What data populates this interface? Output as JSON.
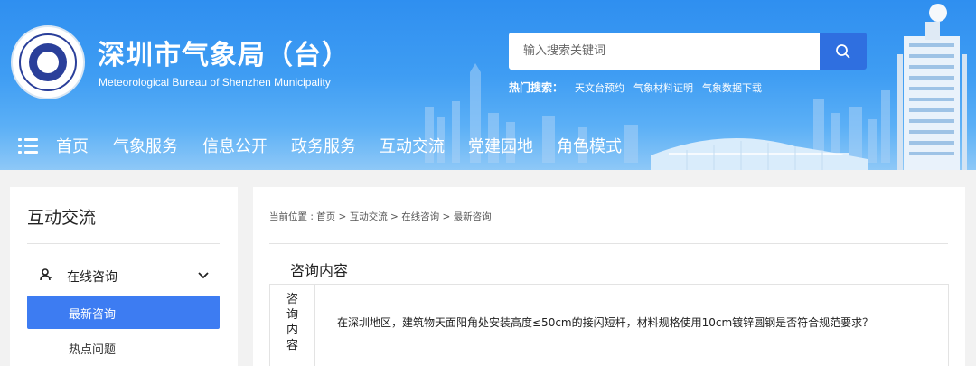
{
  "header": {
    "title": "深圳市气象局（台）",
    "subtitle": "Meteorological Bureau of Shenzhen Municipality",
    "search": {
      "placeholder": "输入搜索关键词"
    },
    "hot_search_label": "热门搜索：",
    "hot_links": [
      "天文台预约",
      "气象材料证明",
      "气象数据下载"
    ]
  },
  "nav": {
    "items": [
      "首页",
      "气象服务",
      "信息公开",
      "政务服务",
      "互动交流",
      "党建园地",
      "角色模式"
    ]
  },
  "sidebar": {
    "title": "互动交流",
    "group_label": "在线咨询",
    "items": [
      "最新咨询",
      "热点问题"
    ],
    "active_index": 0
  },
  "breadcrumb": {
    "prefix": "当前位置 : ",
    "crumbs": [
      "首页",
      "互动交流",
      "在线咨询",
      "最新咨询"
    ],
    "separator": " > "
  },
  "content": {
    "section_title": "咨询内容",
    "row_label": "咨询内容",
    "question": "在深圳地区，建筑物天面阳角处安装高度≤50cm的接闪短杆，材料规格使用10cm镀锌圆钢是否符合规范要求？"
  },
  "colors": {
    "header_blue": "#3f9df3",
    "search_button": "#2f6fe0",
    "active_item": "#3d7cf2"
  }
}
